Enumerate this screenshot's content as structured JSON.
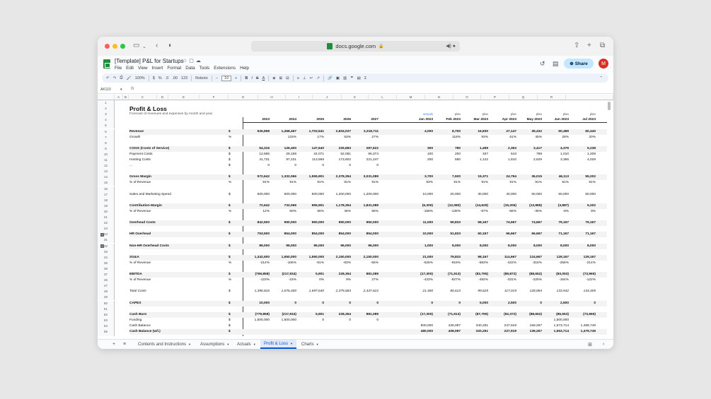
{
  "browser": {
    "url": "docs.google.com"
  },
  "app": {
    "title": "[Template] P&L for Startups",
    "menus": [
      "File",
      "Edit",
      "View",
      "Insert",
      "Format",
      "Data",
      "Tools",
      "Extensions",
      "Help"
    ],
    "share_label": "Share",
    "avatar_initial": "M"
  },
  "toolbar": {
    "zoom": "100%",
    "currency": "$",
    "percent": "%",
    "decimals_down": ".0",
    "decimals_up": ".00",
    "number_format": "123",
    "font": "Roboto",
    "font_size": "10"
  },
  "formula_bar": {
    "name_box": "AK110",
    "fx": "fx"
  },
  "columns": [
    "A",
    "B",
    "C",
    "D",
    "E",
    "F",
    "G",
    "H",
    "I",
    "J",
    "K",
    "L",
    "M",
    "N",
    "O",
    "P",
    "Q",
    "R"
  ],
  "row_numbers": [
    "1",
    "2",
    "3",
    "4",
    "5",
    "6",
    "7",
    "8",
    "9",
    "10",
    "11",
    "12",
    "13",
    "14",
    "15",
    "16",
    "17",
    "18",
    "19",
    "20",
    "21",
    "22",
    "23",
    "24",
    "31",
    "32",
    "33",
    "34",
    "35",
    "36",
    "37",
    "46",
    "47",
    "48",
    "49",
    "50",
    "51",
    "52",
    "53",
    "54",
    "55",
    "56",
    "57"
  ],
  "sheet": {
    "title": "Profit & Loss",
    "subtitle": "Forecast of revenues and expenses by month and year",
    "type_row": [
      "actuals",
      "plan",
      "plan",
      "plan",
      "plan",
      "plan",
      "plan"
    ],
    "year_headers": [
      "2023",
      "2024",
      "2025",
      "2026",
      "2027"
    ],
    "month_headers": [
      "Jan 2023",
      "Feb 2023",
      "Mar 2023",
      "Apr 2023",
      "May 2023",
      "Jun 2023",
      "Jul 2023"
    ],
    "rows": [
      {
        "row": 6,
        "label": "Revenue",
        "unit": "$",
        "bold": true,
        "years": [
          "626,958",
          "1,458,467",
          "1,703,541",
          "2,604,037",
          "3,318,711"
        ],
        "months": [
          "4,000",
          "8,700",
          "16,830",
          "27,147",
          "39,432",
          "50,489",
          "60,440"
        ]
      },
      {
        "row": 7,
        "label": "Growth",
        "unit": "%",
        "years": [
          "",
          "133%",
          "17%",
          "53%",
          "27%"
        ],
        "months": [
          "",
          "118%",
          "93%",
          "61%",
          "45%",
          "28%",
          "20%"
        ]
      },
      {
        "row": 9,
        "label": "COGS (Costs of Service)",
        "unit": "$",
        "bold": true,
        "years": [
          "54,316",
          "126,400",
          "147,640",
          "225,683",
          "287,622"
        ],
        "months": [
          "300",
          "780",
          "1,459",
          "2,353",
          "3,417",
          "4,376",
          "5,238"
        ]
      },
      {
        "row": 10,
        "label": "Payment Costs",
        "unit": "$",
        "years": [
          "12,585",
          "29,169",
          "34,071",
          "52,081",
          "66,374"
        ],
        "months": [
          "100",
          "200",
          "337",
          "543",
          "789",
          "1,010",
          "1,209"
        ]
      },
      {
        "row": 11,
        "label": "Hosting Costs",
        "unit": "$",
        "years": [
          "41,731",
          "97,231",
          "113,569",
          "173,602",
          "221,247"
        ],
        "months": [
          "200",
          "580",
          "1,122",
          "1,810",
          "2,629",
          "3,366",
          "4,029"
        ]
      },
      {
        "row": 12,
        "label": "...",
        "unit": "$",
        "years": [
          "0",
          "0",
          "0",
          "0",
          "0"
        ],
        "months": [
          "",
          "",
          "",
          "",
          "",
          "",
          ""
        ]
      },
      {
        "row": 14,
        "label": "Gross Margin",
        "unit": "$",
        "bold": true,
        "years": [
          "572,642",
          "1,332,066",
          "1,555,901",
          "2,378,354",
          "3,031,089"
        ],
        "months": [
          "3,700",
          "7,920",
          "15,371",
          "24,794",
          "36,015",
          "46,113",
          "55,202"
        ]
      },
      {
        "row": 15,
        "label": "% of Revenue",
        "unit": "%",
        "years": [
          "91%",
          "91%",
          "91%",
          "91%",
          "91%"
        ],
        "months": [
          "93%",
          "91%",
          "91%",
          "91%",
          "91%",
          "91%",
          "91%"
        ]
      },
      {
        "row": 17,
        "label": "Sales and Marketing Spend",
        "unit": "$",
        "years": [
          "500,000",
          "600,000",
          "600,000",
          "1,200,000",
          "1,200,000"
        ],
        "months": [
          "10,000",
          "20,000",
          "30,000",
          "40,000",
          "50,000",
          "50,000",
          "50,000"
        ]
      },
      {
        "row": 19,
        "label": "Contribution Margin",
        "unit": "$",
        "bold": true,
        "years": [
          "72,642",
          "732,066",
          "955,901",
          "1,178,354",
          "1,831,089"
        ],
        "months": [
          "(6,300)",
          "(12,080)",
          "(14,629)",
          "(15,206)",
          "(13,985)",
          "(3,887)",
          "5,202"
        ]
      },
      {
        "row": 20,
        "label": "% of Revenue",
        "unit": "%",
        "years": [
          "12%",
          "50%",
          "56%",
          "45%",
          "55%"
        ],
        "months": [
          "-158%",
          "-139%",
          "-87%",
          "-56%",
          "-35%",
          "-8%",
          "9%"
        ]
      },
      {
        "row": 22,
        "label": "Overhead Costs",
        "unit": "$",
        "bold": true,
        "years": [
          "842,500",
          "950,000",
          "950,000",
          "950,000",
          "950,000"
        ],
        "months": [
          "11,000",
          "59,833",
          "68,167",
          "74,667",
          "74,667",
          "79,167",
          "79,167"
        ]
      },
      {
        "row": 24,
        "label": "HR Overhead",
        "unit": "$",
        "bold": true,
        "years": [
          "753,500",
          "854,000",
          "854,000",
          "854,000",
          "854,000"
        ],
        "months": [
          "10,000",
          "51,833",
          "60,167",
          "66,667",
          "66,667",
          "71,167",
          "71,167"
        ]
      },
      {
        "row": 32,
        "label": "Non-HR Overhead Costs",
        "unit": "$",
        "bold": true,
        "years": [
          "89,000",
          "96,000",
          "96,000",
          "96,000",
          "96,000"
        ],
        "months": [
          "1,000",
          "8,000",
          "8,000",
          "8,000",
          "8,000",
          "8,000",
          "8,000"
        ]
      },
      {
        "row": 34,
        "label": "SG&A",
        "unit": "$",
        "bold": true,
        "years": [
          "1,342,500",
          "1,550,000",
          "1,550,000",
          "2,150,000",
          "2,150,000"
        ],
        "months": [
          "21,000",
          "79,833",
          "98,167",
          "114,667",
          "124,667",
          "129,167",
          "129,167"
        ]
      },
      {
        "row": 35,
        "label": "% of Revenue",
        "unit": "%",
        "years": [
          "-214%",
          "-106%",
          "-91%",
          "-83%",
          "-65%"
        ],
        "months": [
          "-525%",
          "-918%",
          "-583%",
          "-422%",
          "-316%",
          "-256%",
          "-214%"
        ]
      },
      {
        "row": 37,
        "label": "EBITDA",
        "unit": "$",
        "bold": true,
        "years": [
          "(769,858)",
          "(217,934)",
          "5,901",
          "228,354",
          "881,089"
        ],
        "months": [
          "(17,300)",
          "(71,913)",
          "(82,795)",
          "(89,872)",
          "(88,652)",
          "(83,053)",
          "(73,965)"
        ]
      },
      {
        "row": 46,
        "label": "% of Revenue",
        "unit": "%",
        "years": [
          "-123%",
          "-15%",
          "0%",
          "9%",
          "27%"
        ],
        "months": [
          "-433%",
          "-827%",
          "-492%",
          "-331%",
          "-225%",
          "-164%",
          "-122%"
        ]
      },
      {
        "row": 48,
        "label": "Total Costs",
        "unit": "$",
        "italic": true,
        "years": [
          "1,396,816",
          "1,676,400",
          "1,697,640",
          "2,375,683",
          "2,437,622"
        ],
        "months": [
          "21,300",
          "80,613",
          "99,625",
          "117,019",
          "128,084",
          "133,542",
          "134,405"
        ]
      },
      {
        "row": 50,
        "label": "CAPEX",
        "unit": "$",
        "bold": true,
        "years": [
          "10,000",
          "0",
          "0",
          "0",
          "0"
        ],
        "months": [
          "0",
          "0",
          "5,000",
          "2,500",
          "0",
          "2,500",
          "0"
        ]
      },
      {
        "row": 52,
        "label": "Cash Burn",
        "unit": "$",
        "bold": true,
        "years": [
          "(779,858)",
          "(217,934)",
          "5,901",
          "228,354",
          "881,089"
        ],
        "months": [
          "(17,300)",
          "(71,913)",
          "(87,795)",
          "(92,372)",
          "(88,652)",
          "(85,553)",
          "(73,965)"
        ]
      },
      {
        "row": 53,
        "label": "Funding",
        "unit": "$",
        "years": [
          "1,500,000",
          "1,500,000",
          "0",
          "0",
          "0"
        ],
        "months": [
          "",
          "",
          "",
          "",
          "",
          "1,500,000",
          ""
        ]
      },
      {
        "row": 54,
        "label": "Cash Balance",
        "unit": "$",
        "years": [
          "",
          "",
          "",
          "",
          ""
        ],
        "months": [
          "500,000",
          "428,087",
          "340,291",
          "247,919",
          "159,267",
          "1,573,714",
          "1,499,749"
        ]
      },
      {
        "row": 55,
        "label": "Cash Balance (w/l.)",
        "unit": "$",
        "bold": true,
        "years": [
          "",
          "",
          "",
          "",
          ""
        ],
        "months": [
          "480,000",
          "408,087",
          "320,291",
          "227,919",
          "139,267",
          "1,553,714",
          "1,479,749"
        ]
      }
    ]
  },
  "tabs": [
    {
      "label": "Contents and Instructions",
      "active": false
    },
    {
      "label": "Assumptions",
      "active": false
    },
    {
      "label": "Actuals",
      "active": false
    },
    {
      "label": "Profit & Loss",
      "active": true
    },
    {
      "label": "Charts",
      "active": false
    }
  ]
}
